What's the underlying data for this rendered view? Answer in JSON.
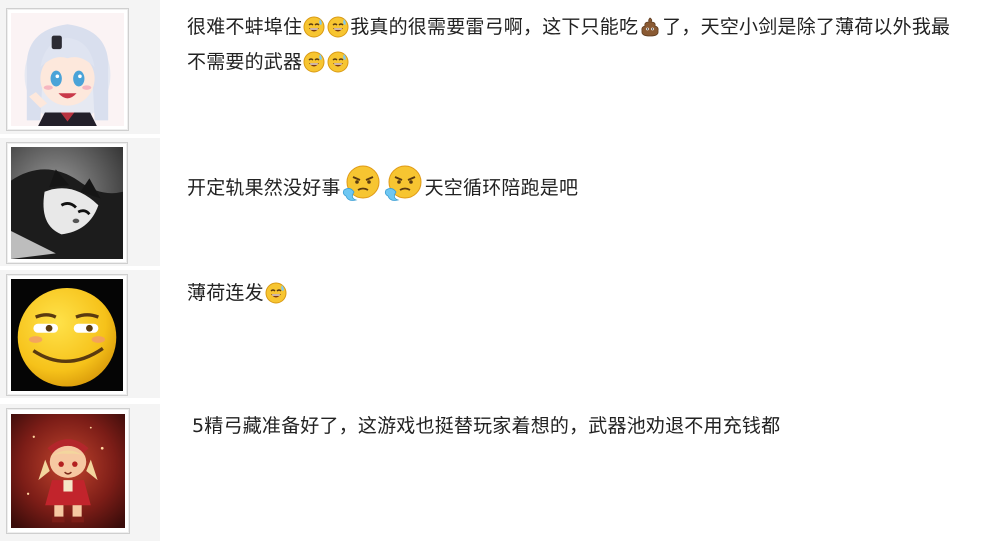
{
  "comments": [
    {
      "avatar": "anime-girl-avatar",
      "segments": [
        "很难不蚌埠住",
        "我真的很需要雷弓啊，这下只能吃",
        "了，天空小剑是除了薄荷以外我最",
        "不需要的武器"
      ]
    },
    {
      "avatar": "cat-avatar",
      "segments": [
        "开定轨果然没好事",
        "天空循环陪跑是吧"
      ]
    },
    {
      "avatar": "smug-face-avatar",
      "segments": [
        "薄荷连发"
      ]
    },
    {
      "avatar": "klee-character-avatar",
      "segments": [
        "5精弓藏准备好了，这游戏也挺替玩家着想的，武器池劝退不用充钱都"
      ]
    }
  ],
  "icons": {
    "sweat_smile": "sweat-smile-emoji-icon",
    "poop": "poop-emoji-icon",
    "angry_steam": "angry-steam-emoji-icon"
  }
}
